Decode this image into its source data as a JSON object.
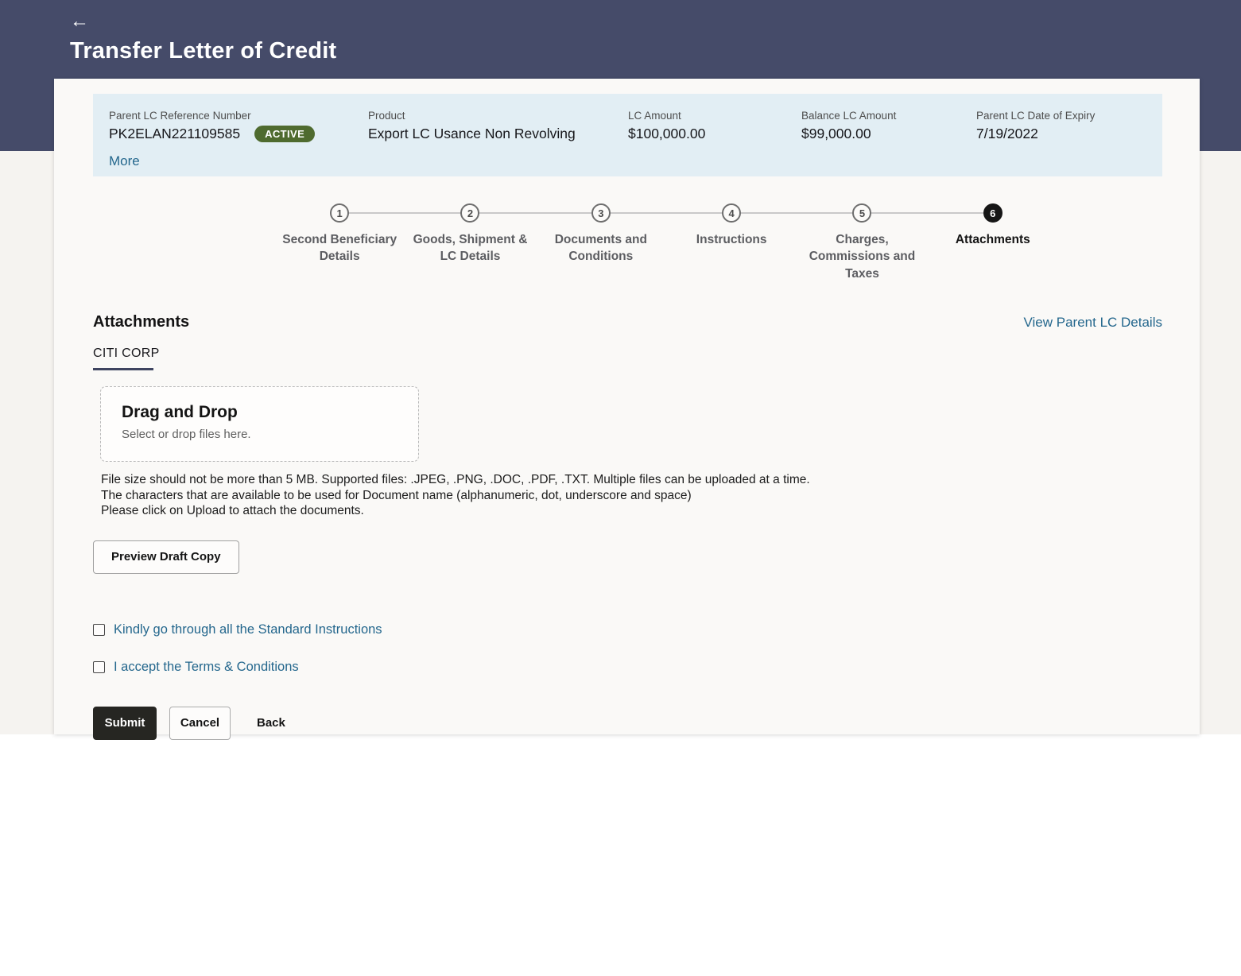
{
  "header": {
    "title": "Transfer Letter of Credit",
    "back_icon": "←"
  },
  "summary": {
    "fields": [
      {
        "label": "Parent LC Reference Number",
        "value": "PK2ELAN221109585",
        "badge": "ACTIVE"
      },
      {
        "label": "Product",
        "value": "Export LC Usance Non Revolving"
      },
      {
        "label": "LC Amount",
        "value": "$100,000.00"
      },
      {
        "label": "Balance LC Amount",
        "value": "$99,000.00"
      },
      {
        "label": "Parent LC Date of Expiry",
        "value": "7/19/2022"
      }
    ],
    "more_label": "More"
  },
  "stepper": {
    "steps": [
      {
        "number": "1",
        "label": "Second Beneficiary Details",
        "active": false
      },
      {
        "number": "2",
        "label": "Goods, Shipment & LC Details",
        "active": false
      },
      {
        "number": "3",
        "label": "Documents and Conditions",
        "active": false
      },
      {
        "number": "4",
        "label": "Instructions",
        "active": false
      },
      {
        "number": "5",
        "label": "Charges, Commissions and Taxes",
        "active": false
      },
      {
        "number": "6",
        "label": "Attachments",
        "active": true
      }
    ]
  },
  "section": {
    "title": "Attachments",
    "view_parent_link": "View Parent LC Details",
    "tab_label": "CITI CORP"
  },
  "upload": {
    "dropzone_title": "Drag and Drop",
    "dropzone_subtitle": "Select or drop files here.",
    "info_lines": [
      "File size should not be more than 5 MB. Supported files: .JPEG, .PNG, .DOC, .PDF, .TXT. Multiple files can be uploaded at a time.",
      "The characters that are available to be used for Document name (alphanumeric, dot, underscore and space)",
      "Please click on Upload to attach the documents."
    ],
    "preview_button": "Preview Draft Copy"
  },
  "acknowledgements": {
    "items": [
      {
        "label": "Kindly go through all the Standard Instructions",
        "checked": false
      },
      {
        "label": "I accept the Terms & Conditions",
        "checked": false
      }
    ]
  },
  "actions": {
    "submit": "Submit",
    "cancel": "Cancel",
    "back": "Back"
  },
  "colors": {
    "header_bg": "#454b69",
    "page_bg": "#f5f3f0",
    "card_bg": "#faf9f7",
    "summary_bar_bg": "#e2eef4",
    "badge_bg": "#4f6b2f",
    "link": "#24678d",
    "active_step": "#161616",
    "submit_bg": "#262622",
    "tab_underline": "#3e4460"
  }
}
